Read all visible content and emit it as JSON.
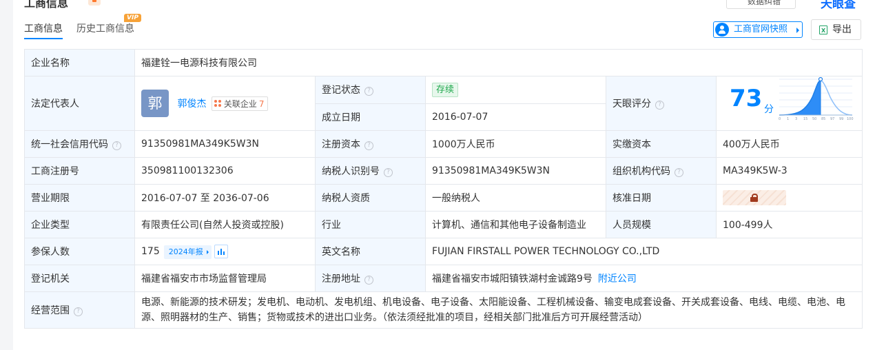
{
  "header": {
    "section_title": "工商信息",
    "top_button": "数据纠错",
    "brand": "天眼查"
  },
  "tabs": [
    {
      "label": "工商信息",
      "active": true
    },
    {
      "label": "历史工商信息",
      "badge": "VIP"
    }
  ],
  "actions": {
    "snapshot": "工商官网快照",
    "export": "导出"
  },
  "rows": {
    "company_name": {
      "label": "企业名称",
      "value": "福建铨一电源科技有限公司"
    },
    "legal_rep": {
      "label": "法定代表人",
      "avatar": "郭",
      "name": "郭俊杰",
      "related_label": "关联企业",
      "related_count": "7"
    },
    "reg_status": {
      "label": "登记状态",
      "value": "存续"
    },
    "found_date": {
      "label": "成立日期",
      "value": "2016-07-07"
    },
    "rating": {
      "label": "天眼评分",
      "score": "73",
      "unit": "分",
      "axis": [
        "0",
        "1",
        "3",
        "15",
        "50",
        "85",
        "97",
        "99",
        "100"
      ]
    },
    "credit_code": {
      "label": "统一社会信用代码",
      "value": "91350981MA349K5W3N"
    },
    "reg_capital": {
      "label": "注册资本",
      "value": "1000万人民币"
    },
    "paid_capital": {
      "label": "实缴资本",
      "value": "400万人民币"
    },
    "reg_no": {
      "label": "工商注册号",
      "value": "350981100132306"
    },
    "taxpayer_id": {
      "label": "纳税人识别号",
      "value": "91350981MA349K5W3N"
    },
    "org_code": {
      "label": "组织机构代码",
      "value": "MA349K5W-3"
    },
    "term": {
      "label": "营业期限",
      "value": "2016-07-07 至 2036-07-06"
    },
    "taxpayer_qual": {
      "label": "纳税人资质",
      "value": "一般纳税人"
    },
    "approve_date": {
      "label": "核准日期"
    },
    "company_type": {
      "label": "企业类型",
      "value": "有限责任公司(自然人投资或控股)"
    },
    "industry": {
      "label": "行业",
      "value": "计算机、通信和其他电子设备制造业"
    },
    "staff_size": {
      "label": "人员规模",
      "value": "100-499人"
    },
    "insured": {
      "label": "参保人数",
      "value": "175",
      "year_tag": "2024年报"
    },
    "english_name": {
      "label": "英文名称",
      "value": "FUJIAN FIRSTALL POWER TECHNOLOGY CO.,LTD"
    },
    "reg_authority": {
      "label": "登记机关",
      "value": "福建省福安市市场监督管理局"
    },
    "reg_address": {
      "label": "注册地址",
      "value": "福建省福安市城阳镇铁湖村金诚路9号",
      "link": "附近公司"
    },
    "scope": {
      "label": "经营范围",
      "value": "电源、新能源的技术研发；发电机、电动机、发电机组、机电设备、电子设备、太阳能设备、工程机械设备、输变电成套设备、开关成套设备、电线、电缆、电池、电源、照明器材的生产、销售；货物或技术的进出口业务。（依法须经批准的项目，经相关部门批准后方可开展经营活动）"
    }
  },
  "colors": {
    "accent": "#0084ff",
    "label_bg": "#f2f8ff",
    "status_green": "#20a94d"
  }
}
